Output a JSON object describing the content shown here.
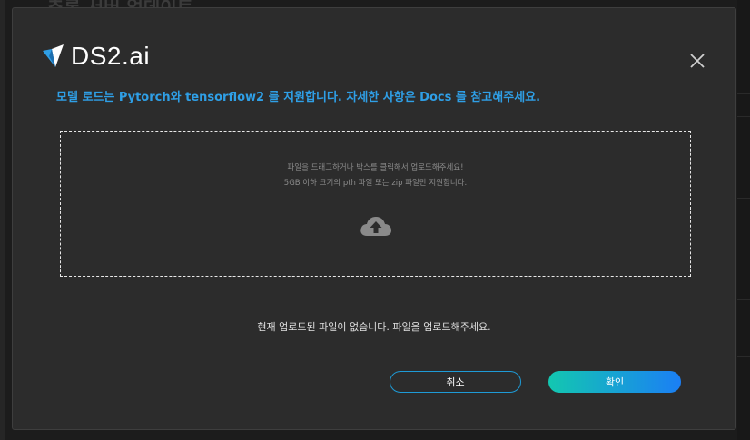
{
  "background": {
    "title": "추론 서버 업데이트"
  },
  "logo": {
    "text": "DS2.ai",
    "accent_color": "#2f9fe6"
  },
  "modal": {
    "notice": "모델 로드는 Pytorch와 tensorflow2 를 지원합니다. 자세한 사항은 Docs 를 참고해주세요.",
    "dropzone": {
      "hint_line1": "파일을 드래그하거나 박스를 클릭해서 업로드해주세요!",
      "hint_line2": "5GB 이하 크기의 pth 파일 또는 zip 파일만 지원합니다.",
      "icon": "cloud-upload-icon"
    },
    "status": "현재 업로드된 파일이 없습니다. 파일을 업로드해주세요.",
    "buttons": {
      "cancel": "취소",
      "confirm": "확인"
    },
    "close_icon": "close-icon"
  }
}
